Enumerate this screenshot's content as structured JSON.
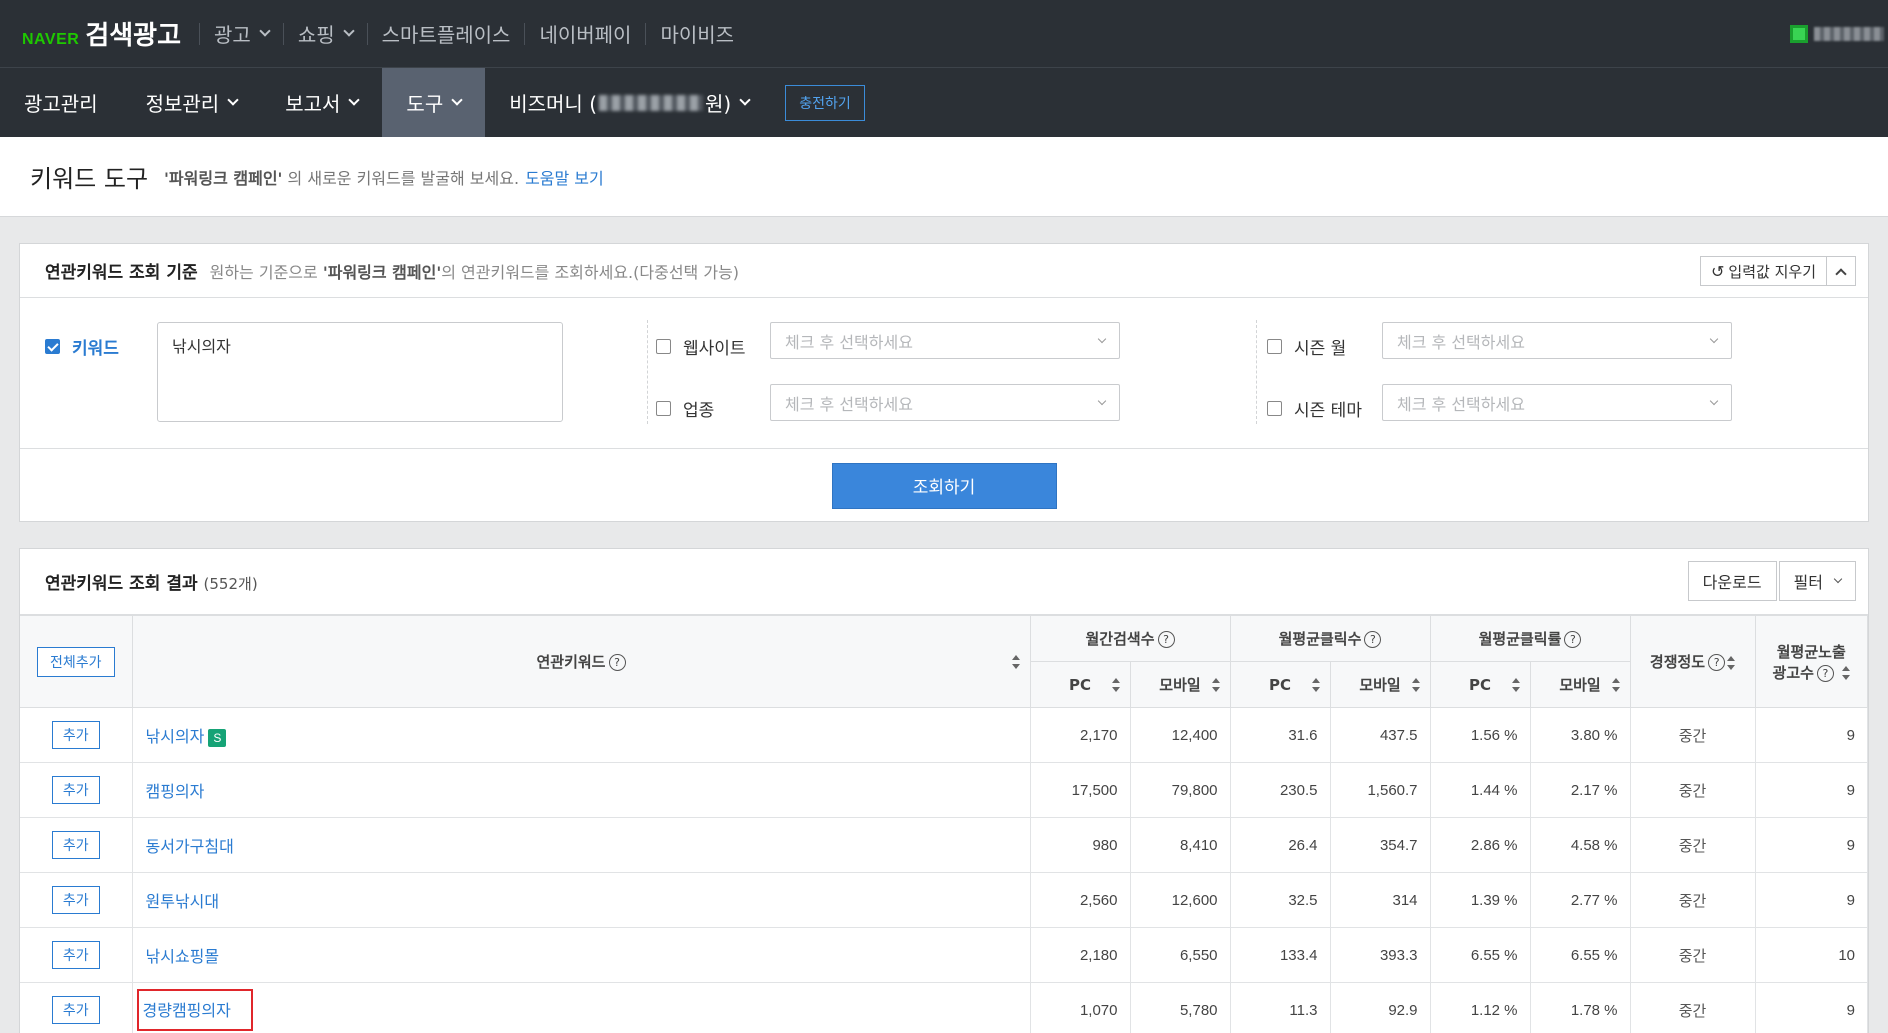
{
  "topbar": {
    "logo_naver": "NAVER",
    "logo_brand": "검색광고",
    "nav": [
      {
        "label": "광고",
        "dropdown": true
      },
      {
        "label": "쇼핑",
        "dropdown": true
      },
      {
        "label": "스마트플레이스",
        "dropdown": false
      },
      {
        "label": "네이버페이",
        "dropdown": false
      },
      {
        "label": "마이비즈",
        "dropdown": false
      }
    ]
  },
  "mainnav": {
    "items": [
      "광고관리",
      "정보관리",
      "보고서",
      "도구"
    ],
    "bizmoney_prefix": "비즈머니 (",
    "bizmoney_suffix": "원)",
    "charge_label": "충전하기"
  },
  "pagehead": {
    "title": "키워드 도구",
    "campaign": "'파워링크 캠페인'",
    "desc": " 의 새로운 키워드를 발굴해 보세요.",
    "help": "도움말 보기"
  },
  "criteria": {
    "title": "연관키워드 조회 기준",
    "desc_pre": "원하는 기준으로 ",
    "desc_campaign": "'파워링크 캠페인'",
    "desc_post": "의 연관키워드를 조회하세요.(다중선택 가능)",
    "reset_label": "입력값 지우기",
    "keyword_label": "키워드",
    "keyword_value": "낚시의자",
    "website_label": "웹사이트",
    "industry_label": "업종",
    "season_month_label": "시즌 월",
    "season_theme_label": "시즌 테마",
    "select_placeholder": "체크 후 선택하세요",
    "search_label": "조회하기"
  },
  "results": {
    "title": "연관키워드 조회 결과",
    "count": "(552개)",
    "download_label": "다운로드",
    "filter_label": "필터",
    "add_all_label": "전체추가",
    "headers": {
      "keyword": "연관키워드",
      "monthly_search": "월간검색수",
      "avg_clicks": "월평균클릭수",
      "avg_ctr": "월평균클릭률",
      "competition": "경쟁정도",
      "avg_ads_line1": "월평균노출",
      "avg_ads_line2": "광고수",
      "pc": "PC",
      "mobile": "모바일"
    },
    "add_label": "추가",
    "rows": [
      {
        "keyword": "낚시의자",
        "badge": "S",
        "pc_search": "2,170",
        "mo_search": "12,400",
        "pc_click": "31.6",
        "mo_click": "437.5",
        "pc_ctr": "1.56 %",
        "mo_ctr": "3.80 %",
        "competition": "중간",
        "ads": "9"
      },
      {
        "keyword": "캠핑의자",
        "badge": "",
        "pc_search": "17,500",
        "mo_search": "79,800",
        "pc_click": "230.5",
        "mo_click": "1,560.7",
        "pc_ctr": "1.44 %",
        "mo_ctr": "2.17 %",
        "competition": "중간",
        "ads": "9"
      },
      {
        "keyword": "동서가구침대",
        "badge": "",
        "pc_search": "980",
        "mo_search": "8,410",
        "pc_click": "26.4",
        "mo_click": "354.7",
        "pc_ctr": "2.86 %",
        "mo_ctr": "4.58 %",
        "competition": "중간",
        "ads": "9"
      },
      {
        "keyword": "원투낚시대",
        "badge": "",
        "pc_search": "2,560",
        "mo_search": "12,600",
        "pc_click": "32.5",
        "mo_click": "314",
        "pc_ctr": "1.39 %",
        "mo_ctr": "2.77 %",
        "competition": "중간",
        "ads": "9"
      },
      {
        "keyword": "낚시쇼핑몰",
        "badge": "",
        "pc_search": "2,180",
        "mo_search": "6,550",
        "pc_click": "133.4",
        "mo_click": "393.3",
        "pc_ctr": "6.55 %",
        "mo_ctr": "6.55 %",
        "competition": "중간",
        "ads": "10"
      },
      {
        "keyword": "경량캠핑의자",
        "badge": "",
        "highlight": true,
        "pc_search": "1,070",
        "mo_search": "5,780",
        "pc_click": "11.3",
        "mo_click": "92.9",
        "pc_ctr": "1.12 %",
        "mo_ctr": "1.78 %",
        "competition": "중간",
        "ads": "9"
      }
    ]
  }
}
